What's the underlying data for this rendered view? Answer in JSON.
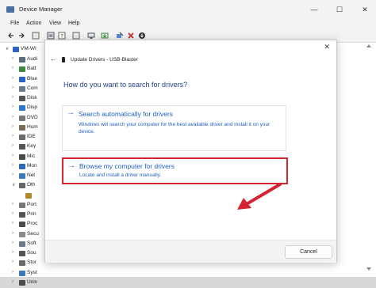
{
  "window": {
    "title": "Device Manager",
    "minimize": "—",
    "maximize": "☐",
    "close": "✕"
  },
  "menu": [
    "File",
    "Action",
    "View",
    "Help"
  ],
  "tree": {
    "root": "VM-WI",
    "items": [
      {
        "label": "Audi",
        "color": "#5a6b7c"
      },
      {
        "label": "Batt",
        "color": "#3c8a3c"
      },
      {
        "label": "Blue",
        "color": "#2a62c9"
      },
      {
        "label": "Com",
        "color": "#6a7a8a"
      },
      {
        "label": "Disk",
        "color": "#555555"
      },
      {
        "label": "Disp",
        "color": "#2a7ac9"
      },
      {
        "label": "DVD",
        "color": "#777777"
      },
      {
        "label": "Hum",
        "color": "#7a6a5a"
      },
      {
        "label": "IDE",
        "color": "#6a6a6a"
      },
      {
        "label": "Key",
        "color": "#555555"
      },
      {
        "label": "Mic",
        "color": "#4a4a4a"
      },
      {
        "label": "Mon",
        "color": "#2a6ab9"
      },
      {
        "label": "Net",
        "color": "#3a7ab9"
      },
      {
        "label": "Oth",
        "color": "#666666"
      },
      {
        "label": "",
        "color": "#b08a2a"
      },
      {
        "label": "Port",
        "color": "#777777"
      },
      {
        "label": "Prin",
        "color": "#555555"
      },
      {
        "label": "Proc",
        "color": "#4a4a4a"
      },
      {
        "label": "Secu",
        "color": "#8a8a8a"
      },
      {
        "label": "Soft",
        "color": "#6a7a8a"
      },
      {
        "label": "Sou",
        "color": "#555555"
      },
      {
        "label": "Stor",
        "color": "#6a6a6a"
      },
      {
        "label": "Syst",
        "color": "#3a7ab9"
      },
      {
        "label": "Univ",
        "color": "#4a4a4a"
      }
    ]
  },
  "dialog": {
    "title": "Update Drivers - USB-Blaster",
    "back": "←",
    "close": "✕",
    "question": "How do you want to search for drivers?",
    "options": [
      {
        "arrow": "→",
        "title": "Search automatically for drivers",
        "desc": "Windows will search your computer for the best available driver and install it on your device."
      },
      {
        "arrow": "→",
        "title": "Browse my computer for drivers",
        "desc": "Locate and install a driver manually."
      }
    ],
    "cancel": "Cancel"
  },
  "colors": {
    "accent": "#1f5fbf",
    "highlight": "#d3242f"
  }
}
